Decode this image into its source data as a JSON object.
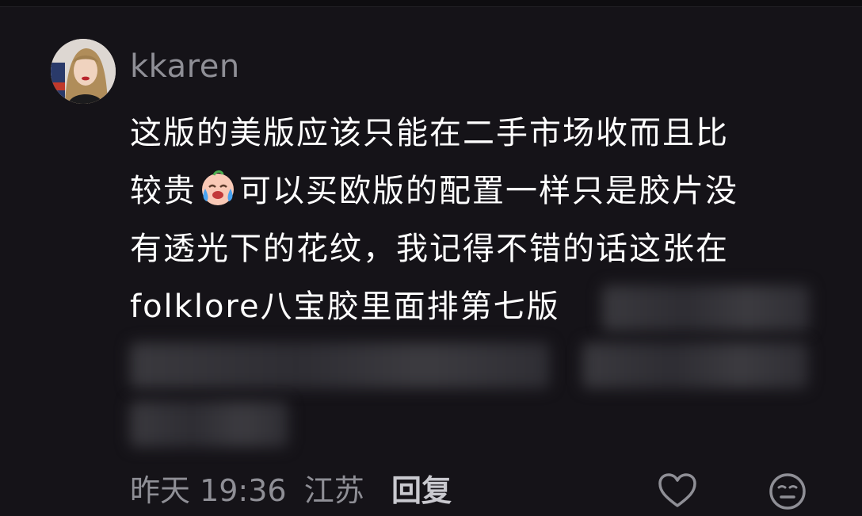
{
  "comment": {
    "username": "kkaren",
    "text_lines": [
      "这版的美版应该只能在二手市场收而且比",
      "较贵",
      "可以买欧版的配置一样只是胶片没",
      "有透光下的花纹，我记得不错的话这张在",
      "folklore八宝胶里面排第七版"
    ],
    "emoji": "crying-laughing-emoji",
    "time": "昨天 19:36",
    "location": "江苏",
    "reply_label": "回复"
  },
  "icons": {
    "avatar": "user-avatar",
    "like": "heart-icon",
    "reaction": "emoji-reaction-icon"
  },
  "colors": {
    "background": "#151318",
    "text": "#ffffff",
    "muted": "#8f8f96"
  }
}
